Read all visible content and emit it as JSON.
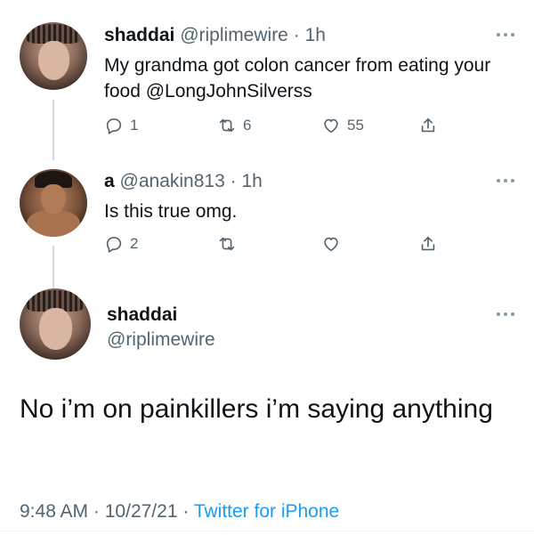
{
  "tweets": [
    {
      "display_name": "shaddai",
      "handle": "@riplimewire",
      "separator": "·",
      "time": "1h",
      "text": "My grandma got colon cancer from eating your food @LongJohnSilverss",
      "actions": {
        "reply_count": "1",
        "retweet_count": "6",
        "like_count": "55"
      }
    },
    {
      "display_name": "a",
      "handle": "@anakin813",
      "separator": "·",
      "time": "1h",
      "text": "Is this true omg.",
      "actions": {
        "reply_count": "2",
        "retweet_count": "",
        "like_count": ""
      }
    }
  ],
  "main_tweet": {
    "display_name": "shaddai",
    "handle": "@riplimewire",
    "text": "No i’m on painkillers i’m saying anything",
    "time": "9:48 AM",
    "separator": "·",
    "date": "10/27/21",
    "source": "Twitter for iPhone"
  },
  "icons": {
    "reply": "reply-icon",
    "retweet": "retweet-icon",
    "like": "heart-icon",
    "share": "share-icon",
    "more": "more-options-icon"
  },
  "colors": {
    "text": "#0f1419",
    "muted": "#536471",
    "link": "#1d9bf0",
    "thread_line": "#cfd9de"
  }
}
